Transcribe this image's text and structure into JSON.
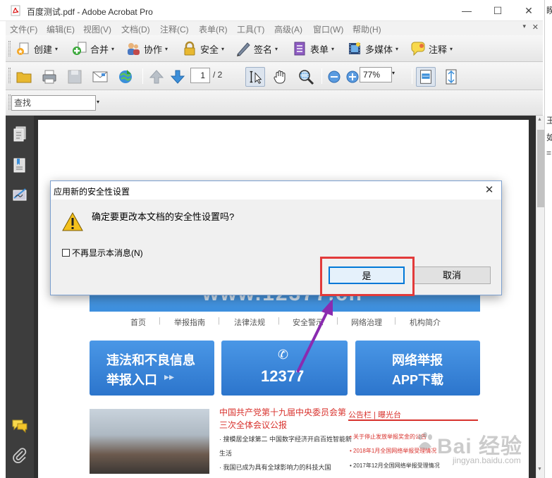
{
  "window": {
    "title": "百度测试.pdf - Adobe Acrobat Pro",
    "minimize": "—",
    "maximize": "☐",
    "close": "✕"
  },
  "menu": {
    "items": [
      "文件(F)",
      "编辑(E)",
      "视图(V)",
      "文档(D)",
      "注释(C)",
      "表单(R)",
      "工具(T)",
      "高级(A)",
      "窗口(W)",
      "帮助(H)"
    ],
    "close": "✕",
    "dropdown": "▾"
  },
  "toolbar1": {
    "create": "创建",
    "combine": "合并",
    "collaborate": "协作",
    "secure": "安全",
    "sign": "签名",
    "forms": "表单",
    "multimedia": "多媒体",
    "comment": "注释",
    "caret": "▾"
  },
  "toolbar2": {
    "page_current": "1",
    "page_total": "/ 2",
    "zoom": "77%",
    "caret": "▾"
  },
  "toolbar3": {
    "find_label": "查找",
    "caret": "▾"
  },
  "document": {
    "banner_text": "www.12377.cn",
    "nav_links": [
      "首页",
      "举报指南",
      "法律法规",
      "安全警示",
      "网络治理",
      "机构简介"
    ],
    "nav_sep": "|",
    "btn_illegal_line1": "违法和不良信息",
    "btn_illegal_line2": "举报入口",
    "btn_illegal_arrow": "▸▸",
    "btn_phone_icon": "✆",
    "btn_phone_number": "12377",
    "btn_app_line1": "网络举报",
    "btn_app_line2": "APP下载",
    "headline_1": "中国共产党第十九届中央委员会第",
    "headline_2": "三次全体会议公报",
    "news_1": "· 搜模居全球第二  中国数字经济开启百姓智能新",
    "news_1b": "生活",
    "news_2": "· 我国已成为具有全球影响力的科技大国",
    "bulletin_title": "公告栏 | 曝光台",
    "bulletin_1": "• 关于停止发放举报奖金的公告",
    "bulletin_2": "• 2018年1月全国网络举报受理情况",
    "bulletin_3": "• 2017年12月全国网络举报受理情况"
  },
  "dialog": {
    "title": "应用新的安全性设置",
    "close": "✕",
    "message": "确定要更改本文档的安全性设置吗?",
    "dont_show": "不再显示本消息(N)",
    "dont_show_checked": false,
    "yes": "是",
    "cancel": "取消"
  },
  "scrollbar": {
    "up": "▲",
    "down": "▼"
  },
  "right_edge": {
    "glyphs": [
      "睽",
      "王",
      "如",
      "="
    ]
  },
  "watermark": {
    "brand": "Bai 经验",
    "url": "jingyan.baidu.com"
  },
  "colors": {
    "annotation_box": "#e23a3a",
    "annotation_arrow": "#8a2bb0",
    "dialog_border": "#7b9fcf",
    "yes_focus": "#0078d7",
    "page_blue": "#3d8fde",
    "news_red": "#d8322d"
  }
}
